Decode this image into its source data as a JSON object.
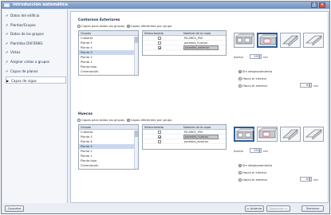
{
  "window": {
    "title": "Introducción automática",
    "help_glyph": "?",
    "close_glyph": "✕"
  },
  "sidebar": {
    "steps": [
      {
        "mark": "✔",
        "label": "Datos del edificio"
      },
      {
        "mark": "✔",
        "label": "Plantas/Grupos"
      },
      {
        "mark": "✔",
        "label": "Datos de los grupos"
      },
      {
        "mark": "✔",
        "label": "Plantillas DXF/DWG"
      },
      {
        "mark": "✔",
        "label": "Vistas"
      },
      {
        "mark": "✔",
        "label": "Asignar vistas a grupos"
      },
      {
        "mark": "✔",
        "label": "Capas de planos"
      },
      {
        "mark": "▶",
        "label": "Capas de vigas"
      }
    ]
  },
  "sections": [
    {
      "title": "Contornos Exteriores",
      "radio_all": "Capas para todos los grupos",
      "radio_diff": "Capas diferentes por grupo",
      "list_header": "Grupos",
      "groups": [
        "Cubierta",
        "Planta 5",
        "Planta 4",
        "Planta 3",
        "Planta 2",
        "Planta 1",
        "Planta baja",
        "Cimentación"
      ],
      "selected_group": 3,
      "table_headers": [
        "Seleccionada",
        "Nombre de la capa"
      ],
      "layers": [
        {
          "checked": false,
          "name": "PILARES_P00",
          "highlight": false
        },
        {
          "checked": false,
          "name": "paredes_huecos",
          "highlight": false
        },
        {
          "checked": true,
          "name": "paredes_exterior",
          "highlight": true
        }
      ],
      "ancho_label": "Ancho",
      "ancho_value": "25",
      "ancho_unit": "cm",
      "options": [
        "Sin desplazamiento",
        "Hacia el interior",
        "Hacia el exterior"
      ],
      "option_selected": 0,
      "offset_value": "0",
      "offset_unit": "cm"
    },
    {
      "title": "Huecos",
      "radio_all": "Capas para todos los grupos",
      "radio_diff": "Capas diferentes por grupo",
      "list_header": "Grupos",
      "groups": [
        "Cubierta",
        "Planta 5",
        "Planta 4",
        "Planta 3",
        "Planta 2",
        "Planta 1",
        "Planta baja",
        "Cimentación"
      ],
      "selected_group": 3,
      "table_headers": [
        "Seleccionada",
        "Nombre de la capa"
      ],
      "layers": [
        {
          "checked": false,
          "name": "PILARES_P00",
          "highlight": false
        },
        {
          "checked": true,
          "name": "paredes_huecos",
          "highlight": true
        },
        {
          "checked": false,
          "name": "paredes_exterior",
          "highlight": false
        }
      ],
      "ancho_label": "Ancho",
      "ancho_value": "25",
      "ancho_unit": "cm",
      "options": [
        "Sin desplazamiento",
        "Hacia el interior",
        "Hacia el exterior"
      ],
      "option_selected": 0,
      "offset_value": "0",
      "offset_unit": "cm"
    }
  ],
  "footer": {
    "cancel": "Cancelar",
    "back": "< Anterior",
    "next": "Siguiente >",
    "finish": "Terminar"
  },
  "colors": {
    "accent": "#2b5e9e",
    "title_bar": "#7f9cc8",
    "highlight_row": "#c9d8ee"
  }
}
